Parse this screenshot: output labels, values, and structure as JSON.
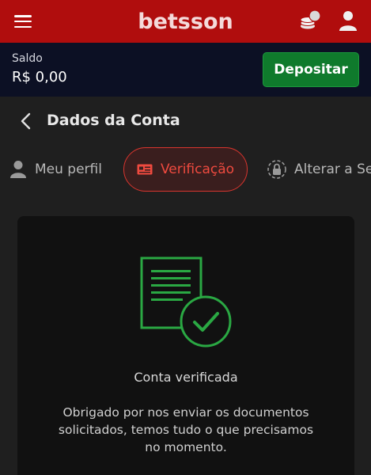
{
  "header": {
    "brand": "betsson",
    "menu_icon": "hamburger-menu-icon",
    "coins_icon": "coins-icon",
    "user_icon": "user-icon",
    "color": "#b00d0d"
  },
  "balance": {
    "label": "Saldo",
    "value": "R$ 0,00",
    "deposit_label": "Depositar",
    "deposit_color": "#0f7a2c"
  },
  "page": {
    "back_icon": "chevron-left-icon",
    "title": "Dados da Conta"
  },
  "tabs": [
    {
      "label": "Meu perfil",
      "icon": "person-icon",
      "active": false
    },
    {
      "label": "Verificação",
      "icon": "id-card-icon",
      "active": true
    },
    {
      "label": "Alterar a Senha",
      "icon": "lock-icon",
      "active": false
    }
  ],
  "verification": {
    "icon": "document-check-icon",
    "accent": "#2aa843",
    "title": "Conta verificada",
    "message": "Obrigado por nos enviar os documentos solicitados, temos tudo o que precisamos no momento."
  }
}
